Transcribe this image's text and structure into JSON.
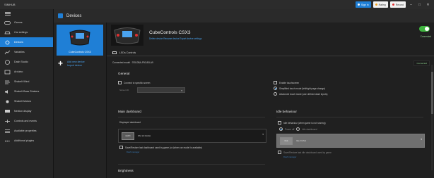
{
  "window": {
    "title": "SIMHUB",
    "buttons": [
      {
        "label": "Sign in",
        "style": "blue"
      },
      {
        "label": "Rating",
        "style": "white"
      },
      {
        "label": "Record",
        "style": "white"
      }
    ],
    "controls": [
      "–",
      "□",
      "✕"
    ]
  },
  "nav": {
    "items": [
      {
        "label": "Games",
        "icon": "gamepad-icon"
      },
      {
        "label": "Car settings",
        "icon": "car-icon"
      },
      {
        "label": "Devices",
        "icon": "devices-icon",
        "active": true
      },
      {
        "label": "Variables",
        "icon": "chart-icon"
      },
      {
        "label": "Dash Studio",
        "icon": "gauge-icon"
      },
      {
        "label": "Arduino",
        "icon": "arduino-icon"
      },
      {
        "label": "ShakeIt Wind",
        "icon": "wind-icon"
      },
      {
        "label": "ShakeIt Bass Shakers",
        "icon": "speaker-icon"
      },
      {
        "label": "ShakeIt Motors",
        "icon": "motor-icon"
      },
      {
        "label": "Nextion display",
        "icon": "display-icon"
      },
      {
        "label": "Controls and events",
        "icon": "controls-icon"
      },
      {
        "label": "Available properties",
        "icon": "list-icon"
      },
      {
        "label": "Additional plugins",
        "icon": "plugins-icon"
      }
    ]
  },
  "devices_header": {
    "title": "Devices"
  },
  "device_list": {
    "selected_label": "CubeControls CSX3",
    "add_label": "Add new device",
    "import_label": "Import device"
  },
  "device": {
    "name": "CubeControls CSX3",
    "links": "Delete device   Rename device   Export device settings",
    "connected_label": "Connected",
    "tab_label": "LEDs   Controls",
    "model_row": "Connected model : 70510BA-P50-80LA9",
    "badge": "Connected"
  },
  "general": {
    "title": "General",
    "connect_specific": "Connect to specific screen",
    "screen_id_label": "Screen ID",
    "enable_touch": "Enable touchscreen",
    "touch_simplified": "Simplified touch mode (left/right page change)",
    "touch_advanced": "Advanced touch mode (use defined dash inputs)"
  },
  "main_dashboard": {
    "title": "Main dashboard",
    "displayed_label": "Displayed dashboard",
    "selected_dash": "NM 10 DASH",
    "thumb_text": "DASH",
    "save_restore": "Save/Restore last dashboard used by game (or (when car model is available)",
    "dash_link": "Dash manager"
  },
  "idle": {
    "title": "Idle behaviour",
    "idle_when_not_running": "Idle behaviour (when game is not running)",
    "power_off": "Power off",
    "idle_dashboard": "Idle dashboard",
    "selected_dash": "Idle DASH",
    "thumb_text": "IDLE",
    "save_restore": "Save/Restore last idle dashboard used by game",
    "link": "Dash manager"
  },
  "brightness": {
    "title": "Brightness"
  },
  "colors": {
    "accent": "#1f7fd6",
    "toggle_on": "#3fb43f"
  }
}
